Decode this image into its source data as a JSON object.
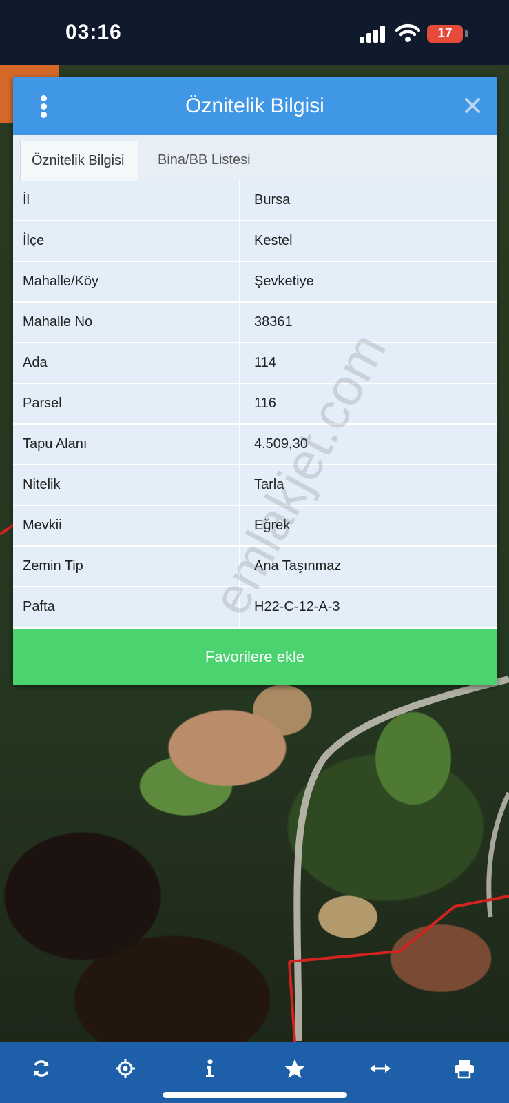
{
  "status_bar": {
    "time": "03:16",
    "battery": "17"
  },
  "dialog": {
    "title": "Öznitelik Bilgisi",
    "tabs": [
      {
        "label": "Öznitelik Bilgisi",
        "active": true
      },
      {
        "label": "Bina/BB Listesi",
        "active": false
      }
    ],
    "rows": [
      {
        "key": "İl",
        "value": "Bursa"
      },
      {
        "key": "İlçe",
        "value": "Kestel"
      },
      {
        "key": "Mahalle/Köy",
        "value": "Şevketiye"
      },
      {
        "key": "Mahalle No",
        "value": "38361"
      },
      {
        "key": "Ada",
        "value": "114"
      },
      {
        "key": "Parsel",
        "value": "116"
      },
      {
        "key": "Tapu Alanı",
        "value": "4.509,30"
      },
      {
        "key": "Nitelik",
        "value": "Tarla"
      },
      {
        "key": "Mevkii",
        "value": "Eğrek"
      },
      {
        "key": "Zemin Tip",
        "value": "Ana Taşınmaz"
      },
      {
        "key": "Pafta",
        "value": "H22-C-12-A-3"
      }
    ],
    "favorite_button": "Favorilere ekle"
  },
  "watermark": "emlakjet.com",
  "toolbar": {
    "icons": [
      "refresh-icon",
      "locate-icon",
      "info-icon",
      "star-icon",
      "measure-icon",
      "print-icon"
    ]
  },
  "colors": {
    "header": "#3f97e6",
    "row_bg": "#e3eef9",
    "favorite": "#4bd36f",
    "toolbar": "#1d5fa8",
    "battery": "#e64b3a"
  }
}
